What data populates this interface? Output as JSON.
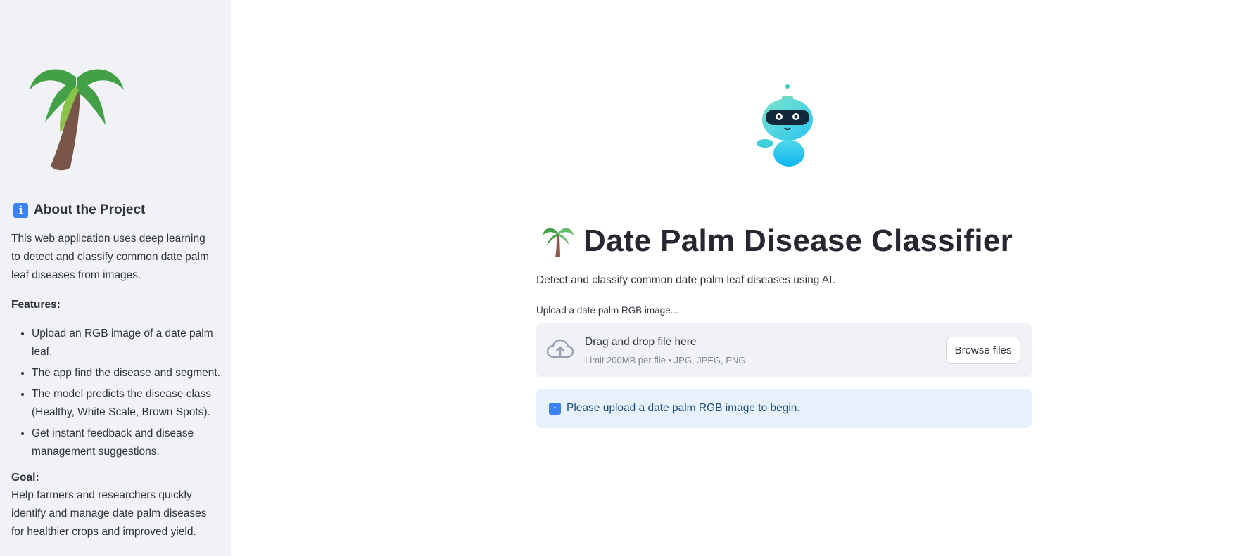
{
  "sidebar": {
    "logo_icon": "palm-tree-icon",
    "about_icon": "info-icon",
    "about_heading": "About the Project",
    "intro": "This web application uses deep learning to detect and classify common date palm leaf diseases from images.",
    "features_label": "Features:",
    "features": [
      "Upload an RGB image of a date palm leaf.",
      "The app find the disease and segment.",
      "The model predicts the disease class (Healthy, White Scale, Brown Spots).",
      "Get instant feedback and disease management suggestions."
    ],
    "goal_label": "Goal:",
    "goal_text": "Help farmers and researchers quickly identify and manage date palm diseases for healthier crops and improved yield."
  },
  "main": {
    "mascot_icon": "robot-icon",
    "title_icon": "palm-tree-icon",
    "title": "Date Palm Disease Classifier",
    "subtitle": "Detect and classify common date palm leaf diseases using AI.",
    "uploader": {
      "label": "Upload a date palm RGB image...",
      "icon": "cloud-upload-icon",
      "drop_text": "Drag and drop file here",
      "limit_text": "Limit 200MB per file • JPG, JPEG, PNG",
      "browse_label": "Browse files"
    },
    "info": {
      "icon": "up-arrow-icon",
      "text": "Please upload a date palm RGB image to begin."
    }
  },
  "colors": {
    "sidebar_bg": "#f0f2f6",
    "info_bg": "#e6f1fb",
    "info_text": "#1f4e79",
    "dropzone_bg": "#f0f2f6"
  }
}
